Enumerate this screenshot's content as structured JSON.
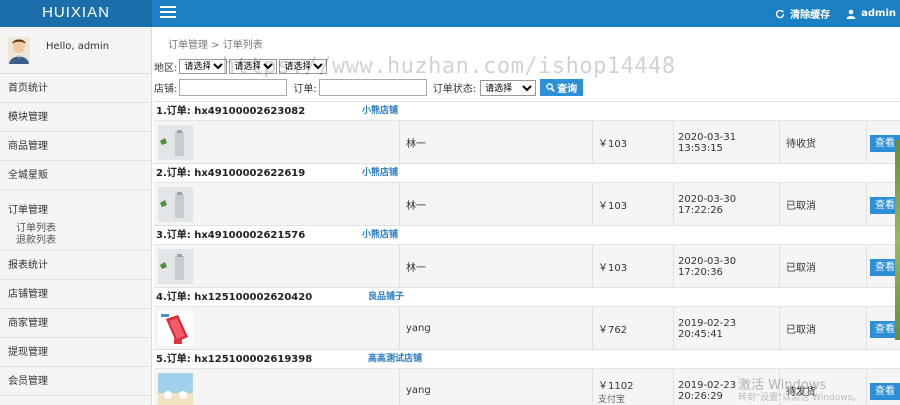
{
  "app": {
    "logo": "HUIXIAN",
    "clear_cache": "清除缓存",
    "admin": "admin"
  },
  "sidebar": {
    "greeting": "Hello, admin",
    "items": [
      {
        "label": "首页统计"
      },
      {
        "label": "模块管理"
      },
      {
        "label": "商品管理"
      },
      {
        "label": "全城星贩"
      }
    ],
    "order_group": {
      "label": "订单管理",
      "subs": [
        "订单列表",
        "退款列表"
      ]
    },
    "items_after": [
      {
        "label": "报表统计"
      },
      {
        "label": "店铺管理"
      },
      {
        "label": "商家管理"
      },
      {
        "label": "提现管理"
      },
      {
        "label": "会员管理"
      }
    ]
  },
  "breadcrumb": "订单管理 > 订单列表",
  "filter": {
    "region_label": "地区:",
    "region_selects": [
      "请选择",
      "请选择",
      "请选择"
    ],
    "shop_label": "店铺:",
    "order_label": "订单:",
    "status_label": "订单状态:",
    "status_select": "请选择",
    "search_label": "查询"
  },
  "watermark": "https://www.huzhan.com/ishop14448",
  "orders": [
    {
      "title": "1.订单: hx49100002623082",
      "shop": "小熊店铺",
      "buyer": "林一",
      "price": "￥103",
      "time": "2020-03-31 13:53:15",
      "status": "待收货",
      "view": "查看"
    },
    {
      "title": "2.订单: hx49100002622619",
      "shop": "小熊店铺",
      "buyer": "林一",
      "price": "￥103",
      "time": "2020-03-30 17:22:26",
      "status": "已取消",
      "view": "查看"
    },
    {
      "title": "3.订单: hx49100002621576",
      "shop": "小熊店铺",
      "buyer": "林一",
      "price": "￥103",
      "time": "2020-03-30 17:20:36",
      "status": "已取消",
      "view": "查看"
    },
    {
      "title": "4.订单: hx125100002620420",
      "shop": "良品铺子",
      "buyer": "yang",
      "price": "￥762",
      "time": "2019-02-23 20:45:41",
      "status": "已取消",
      "view": "查看"
    },
    {
      "title": "5.订单: hx125100002619398",
      "shop": "高高测试店铺",
      "buyer": "yang",
      "price": "￥1102",
      "price_sub": "支付宝",
      "time": "2019-02-23 20:26:29",
      "status": "待发货",
      "view": "查看"
    }
  ],
  "windows_watermark": {
    "line1": "激活 Windows",
    "line2": "转到\"设置\"以激活 Windows。"
  }
}
